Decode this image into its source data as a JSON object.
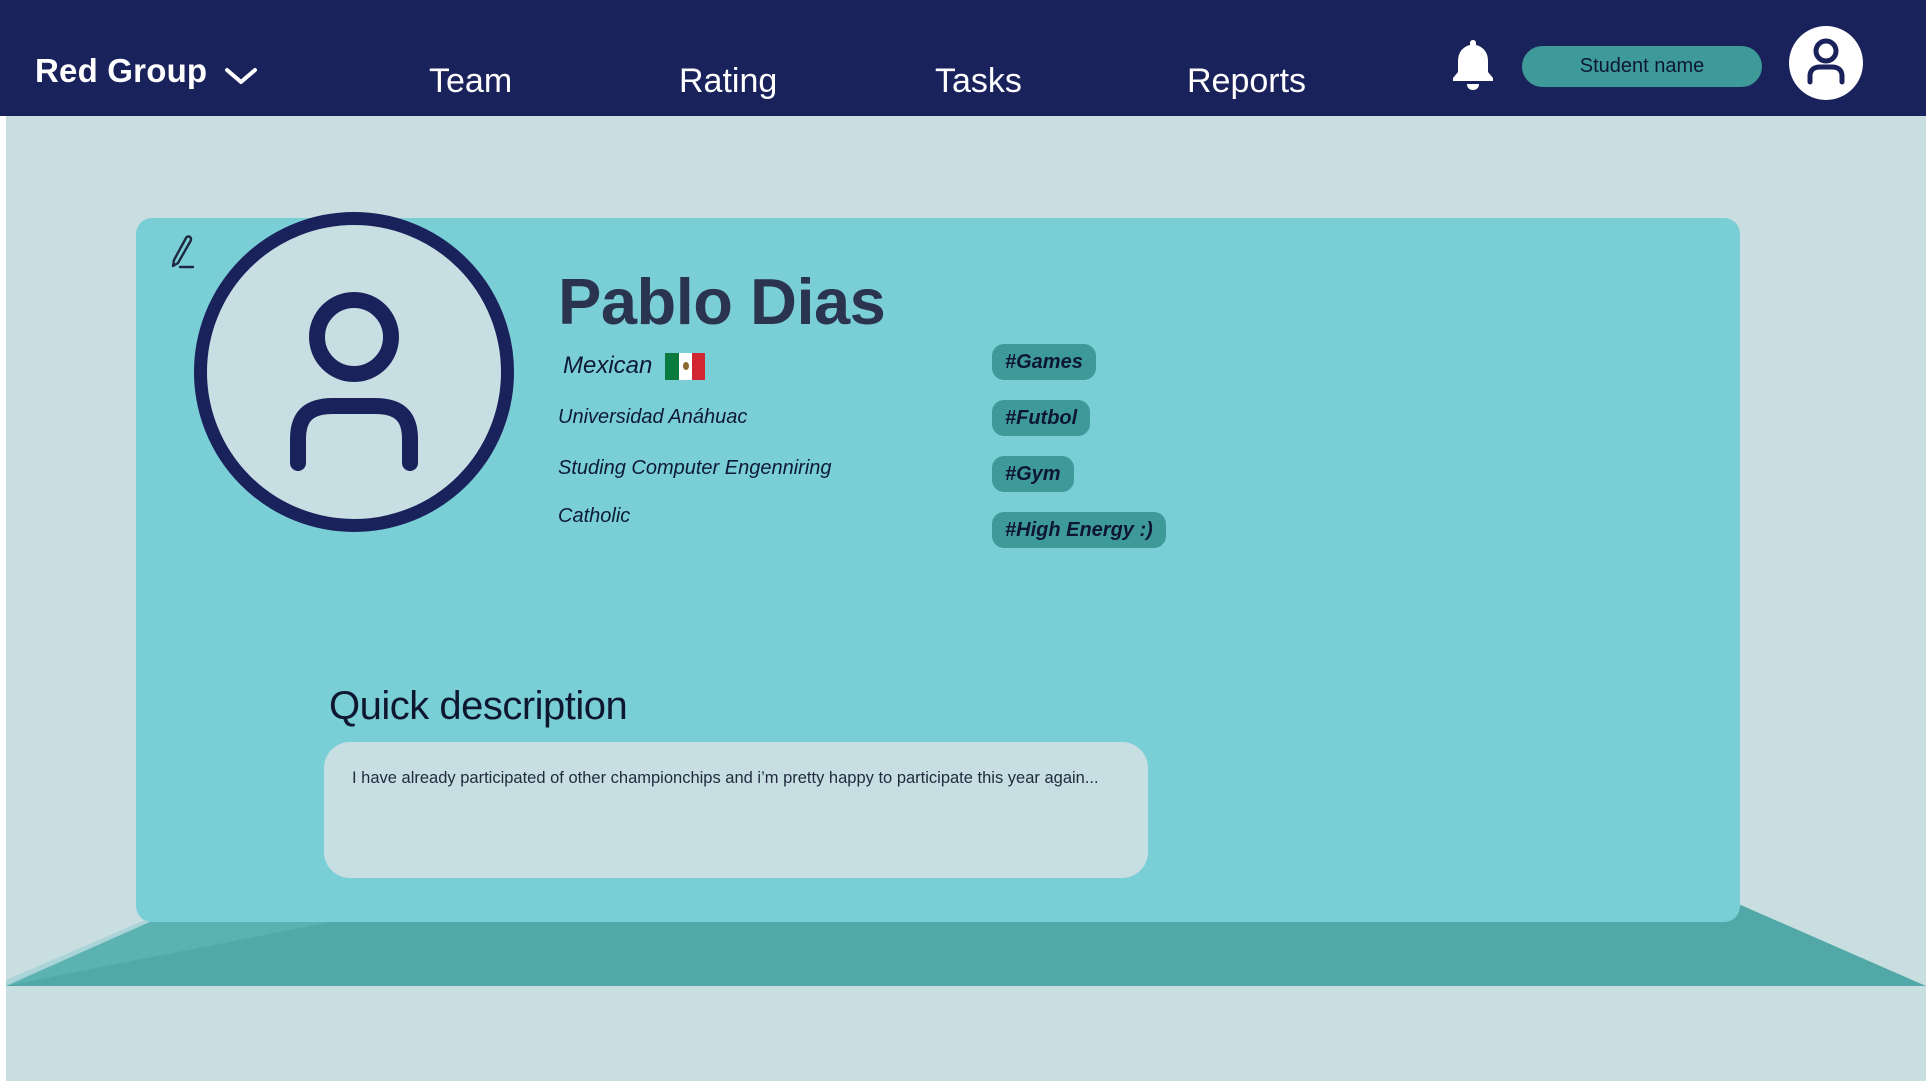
{
  "header": {
    "group_name": "Red Group",
    "group_dropdown_icon": "chevron-down-icon",
    "nav": [
      {
        "label": "Team"
      },
      {
        "label": "Rating"
      },
      {
        "label": "Tasks"
      },
      {
        "label": "Reports"
      }
    ],
    "notification_icon": "bell-icon",
    "student_button_label": "Student name",
    "account_icon": "user-icon"
  },
  "profile": {
    "edit_icon": "pencil-icon",
    "avatar_icon": "user-icon",
    "name": "Pablo Dias",
    "nationality": "Mexican",
    "flag_icon": "mexico-flag-icon",
    "university": "Universidad Anáhuac",
    "studies": "Studing Computer Engenniring",
    "religion": "Catholic",
    "tags": [
      "#Games",
      "#Futbol",
      "#Gym",
      "#High Energy :)"
    ],
    "description_title": "Quick description",
    "description": "I have already participated of other championchips and i’m pretty happy to participate this year again..."
  },
  "colors": {
    "navbar": "#1a225c",
    "background": "#c9dee1",
    "card": "#7acfd6",
    "accent": "#3e9a99",
    "floor": "#52a8a6"
  }
}
